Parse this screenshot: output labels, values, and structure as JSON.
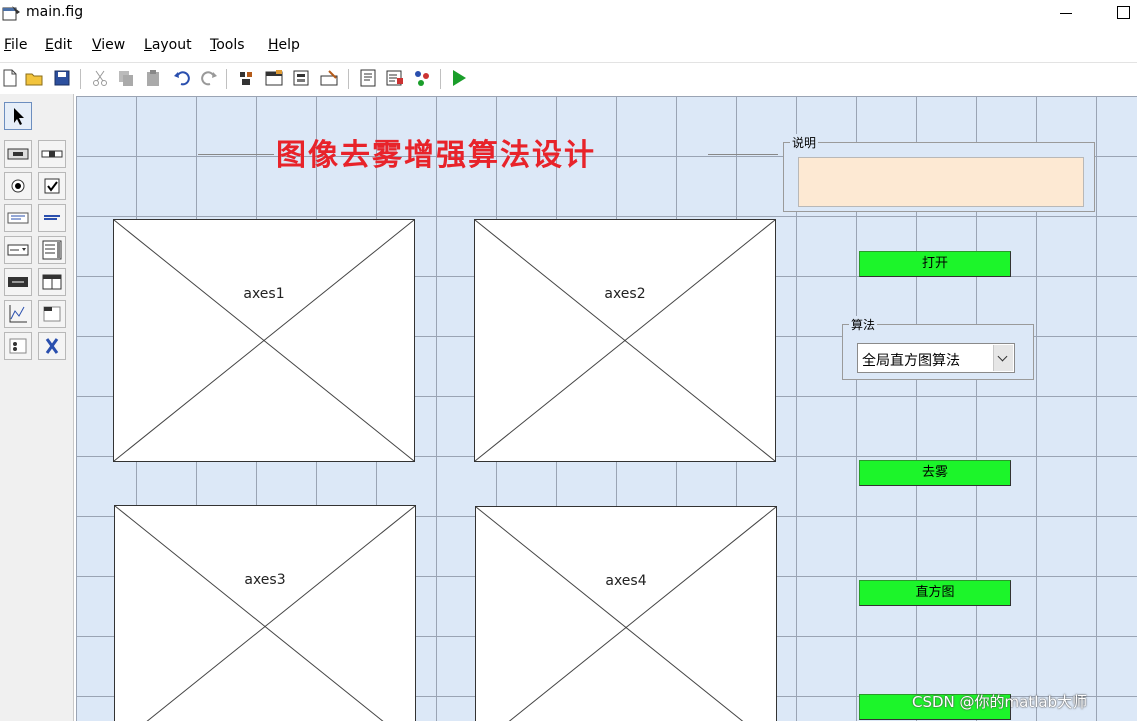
{
  "window": {
    "title": "main.fig"
  },
  "menu": [
    {
      "mnemonic": "F",
      "rest": "ile"
    },
    {
      "mnemonic": "E",
      "rest": "dit"
    },
    {
      "mnemonic": "V",
      "rest": "iew"
    },
    {
      "mnemonic": "L",
      "rest": "ayout"
    },
    {
      "mnemonic": "T",
      "rest": "ools"
    },
    {
      "mnemonic": "H",
      "rest": "elp"
    }
  ],
  "toolbar": {
    "icons": [
      "new-file-icon",
      "open-folder-icon",
      "save-icon",
      "cut-icon",
      "copy-icon",
      "paste-icon",
      "undo-icon",
      "redo-icon",
      "align-objects-icon",
      "menu-editor-icon",
      "tab-order-icon",
      "toolbar-editor-icon",
      "editor-icon",
      "property-inspector-icon",
      "object-browser-icon",
      "run-icon"
    ],
    "run_color": "#1a9e2a"
  },
  "palette": {
    "tools": [
      "select-arrow-icon",
      "push-button-icon",
      "slider-icon",
      "radio-button-icon",
      "checkbox-icon",
      "edit-text-icon",
      "static-text-icon",
      "popup-menu-icon",
      "listbox-icon",
      "toggle-button-icon",
      "table-icon",
      "axes-icon",
      "panel-icon",
      "button-group-icon",
      "activex-icon"
    ]
  },
  "canvas": {
    "title": "图像去雾增强算法设计",
    "title_color": "#e8232a",
    "background_color": "#dce8f7",
    "axes": [
      {
        "label": "axes1"
      },
      {
        "label": "axes2"
      },
      {
        "label": "axes3"
      },
      {
        "label": "axes4"
      }
    ],
    "description_panel": {
      "title": "说明",
      "box_color": "#fde9d3"
    },
    "buttons": {
      "open": "打开",
      "dehaze": "去雾",
      "histogram": "直方图",
      "color": "#1cf52a"
    },
    "algorithm_panel": {
      "title": "算法",
      "selected": "全局直方图算法"
    }
  },
  "watermark": "CSDN @你的matlab大师"
}
